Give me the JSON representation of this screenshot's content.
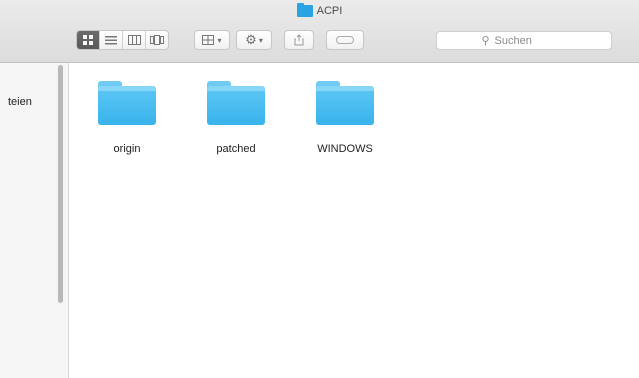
{
  "window": {
    "title": "ACPI"
  },
  "toolbar": {
    "view_modes": [
      "icons",
      "list",
      "columns",
      "cover-flow"
    ],
    "active_view": "icons",
    "search_placeholder": "Suchen"
  },
  "sidebar": {
    "visible_label": "teien"
  },
  "folders": [
    {
      "name": "origin"
    },
    {
      "name": "patched"
    },
    {
      "name": "WINDOWS"
    }
  ],
  "colors": {
    "folder": "#38b3ec",
    "titlebar": "#dcdcdc"
  }
}
